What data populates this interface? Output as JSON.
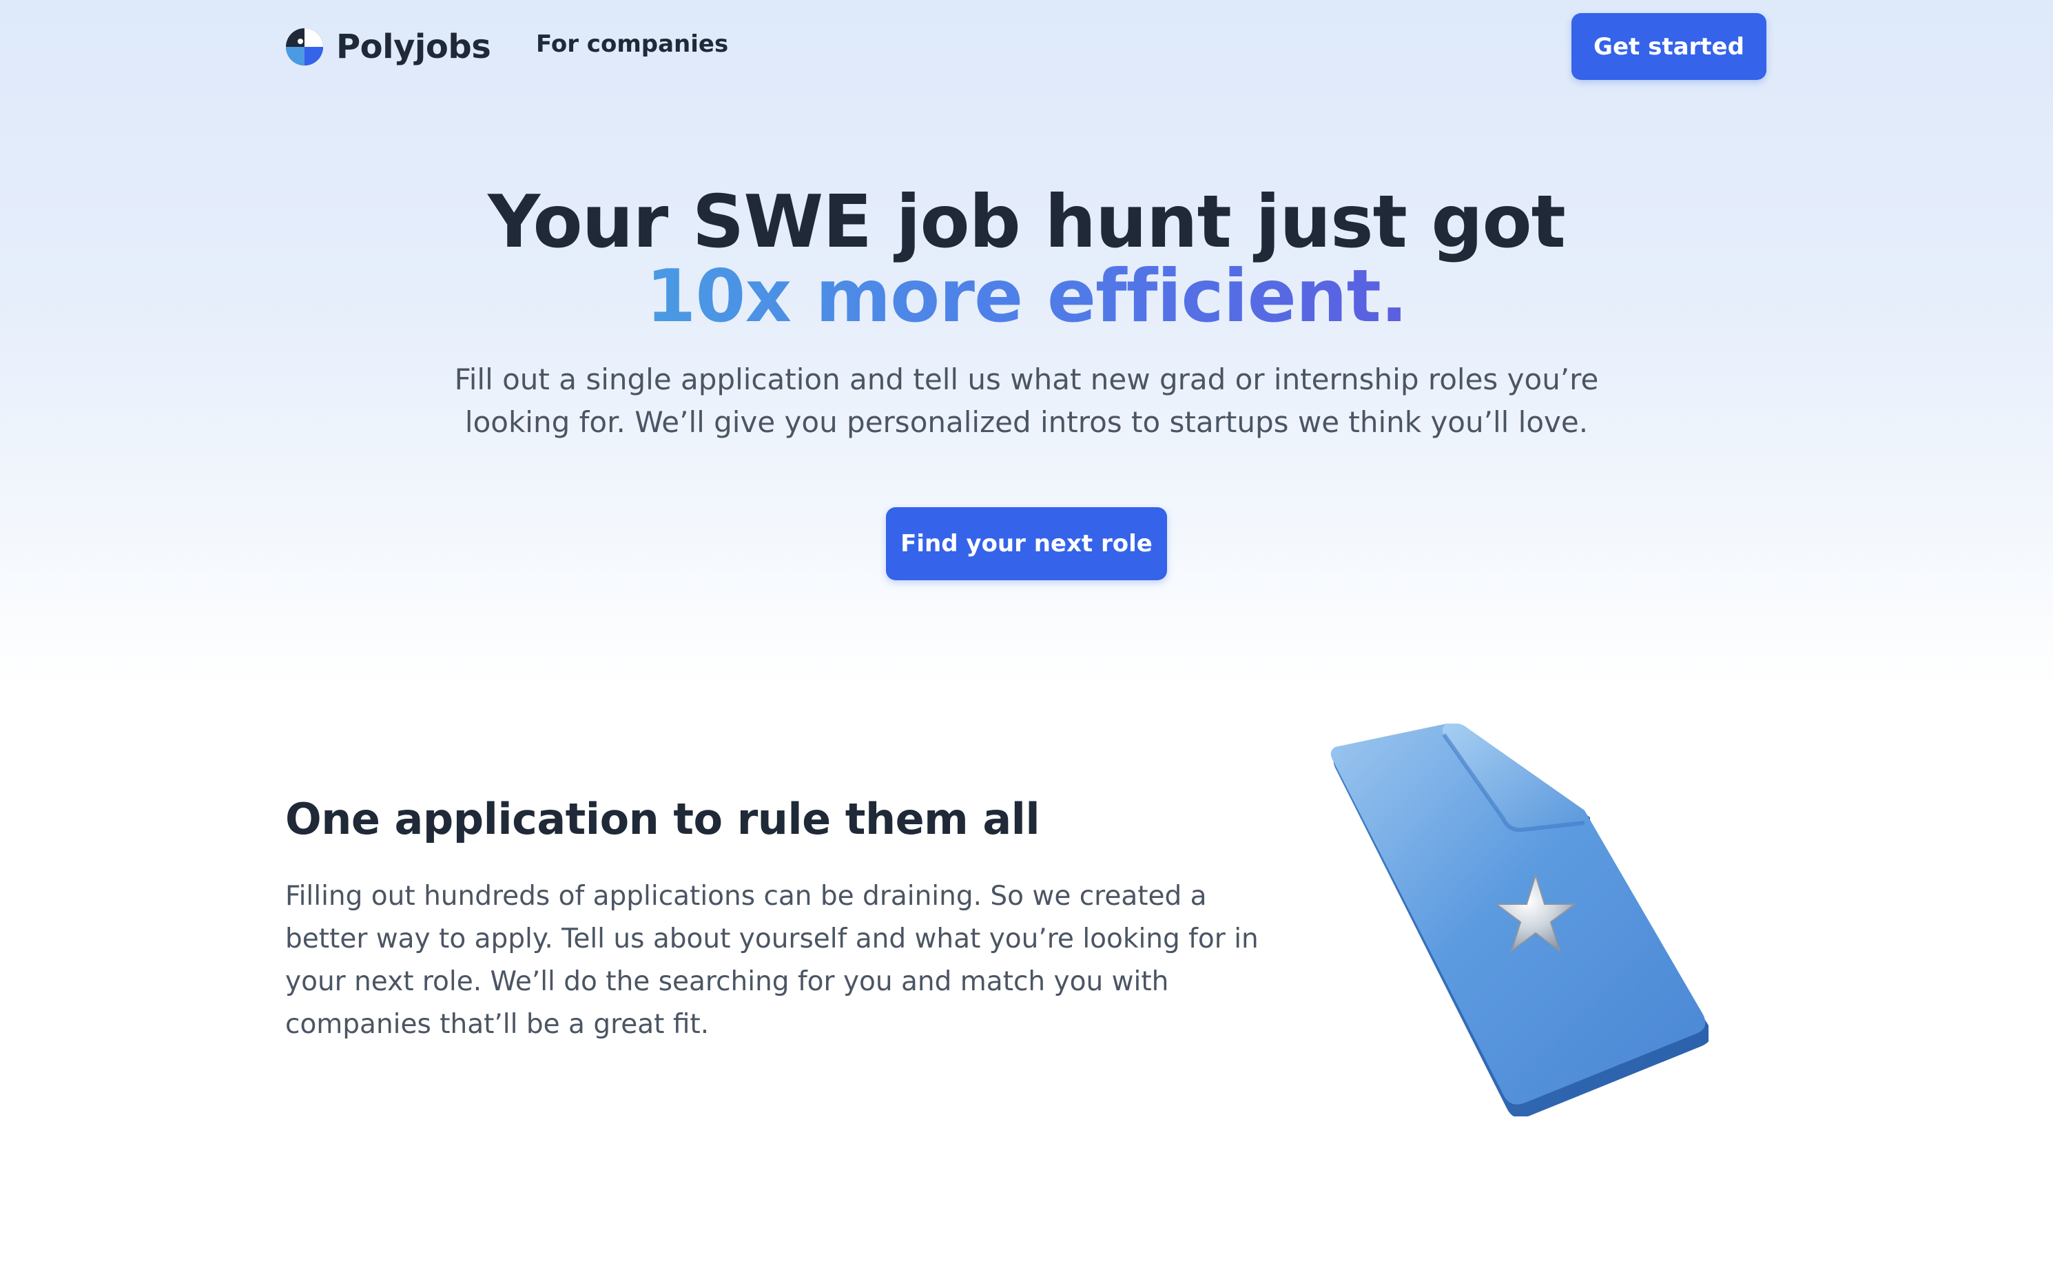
{
  "nav": {
    "brand_name": "Polyjobs",
    "logo_icon": "polyjobs-parrot-logo",
    "for_companies_label": "For companies",
    "get_started_label": "Get started"
  },
  "hero": {
    "title_line1": "Your SWE job hunt just got",
    "title_line2": "10x more efficient.",
    "subtitle": "Fill out a single application and tell us what new grad or internship roles you’re looking for. We’ll give you personalized intros to startups we think you’ll love.",
    "cta_label": "Find your next role"
  },
  "feature": {
    "title": "One application to rule them all",
    "text": "Filling out hundreds of applications can be draining. So we created a better way to apply. Tell us about yourself and what you’re looking for in your next role. We’ll do the searching for you and match you with companies that’ll be a great fit.",
    "illustration_icon": "document-star-icon"
  },
  "colors": {
    "accent": "#3563e9",
    "heading": "#1f2937",
    "body_text": "#4b5563",
    "gradient_start": "#4a9ae4",
    "gradient_end": "#5a5fe0"
  }
}
